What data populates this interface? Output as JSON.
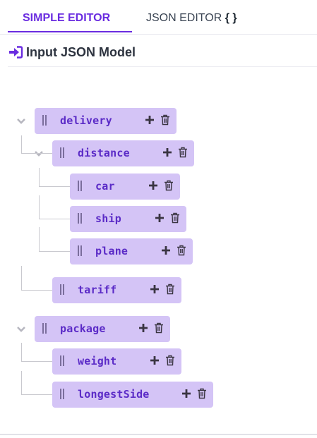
{
  "tabs": {
    "simple_label": "SIMPLE EDITOR",
    "json_label": "JSON EDITOR",
    "json_braces": "{ }",
    "active": "SIMPLE EDITOR"
  },
  "section": {
    "title": "Input JSON Model",
    "icon": "sign-in-icon"
  },
  "tree": {
    "delivery": "delivery",
    "distance": "distance",
    "car": "car",
    "ship": "ship",
    "plane": "plane",
    "tariff": "tariff",
    "package": "package",
    "weight": "weight",
    "longestSide": "longestSide"
  },
  "colors": {
    "accent": "#6a2ce0",
    "node_bg": "#d4c4f6",
    "node_text": "#5b2bc7"
  }
}
